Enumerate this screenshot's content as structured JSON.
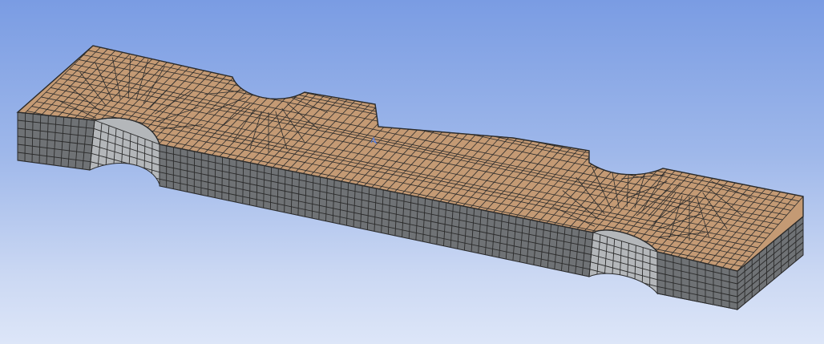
{
  "viewport": {
    "background_top": "#7a9ce3",
    "background_bottom": "#dde6f8"
  },
  "model": {
    "description_icon": "mesh-model",
    "top_face_color": "#c49a74",
    "side_face_color": "#6f7275",
    "cutout_face_color": "#b4b7ba",
    "mesh_line_color": "#2b2b2b",
    "element_type": "hexahedral",
    "thickness_layers": 6
  },
  "view_center_marker": {
    "color": "#5c7fd6",
    "icon": "pivot-point-icon"
  }
}
